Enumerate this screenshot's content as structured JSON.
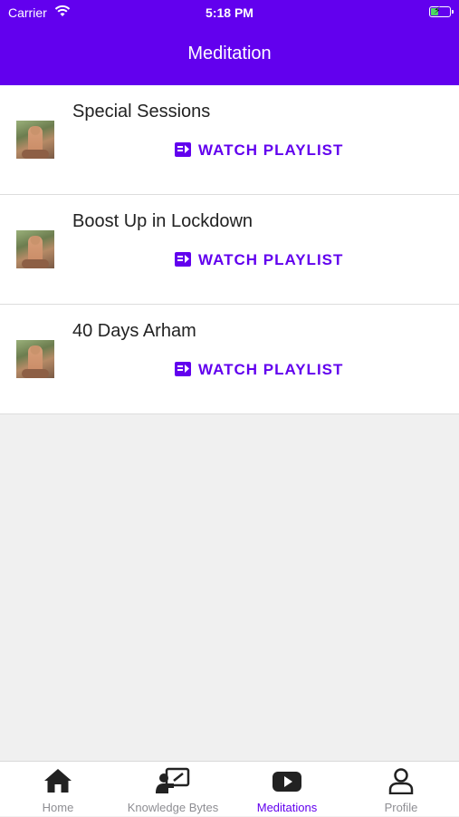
{
  "status_bar": {
    "carrier": "Carrier",
    "time": "5:18 PM",
    "battery_level": 0.4
  },
  "header": {
    "title": "Meditation"
  },
  "playlists": [
    {
      "title": "Special Sessions",
      "action_label": "WATCH PLAYLIST"
    },
    {
      "title": "Boost Up in Lockdown",
      "action_label": "WATCH PLAYLIST"
    },
    {
      "title": "40 Days Arham",
      "action_label": "WATCH PLAYLIST"
    }
  ],
  "tabs": [
    {
      "label": "Home",
      "icon": "home-icon",
      "active": false
    },
    {
      "label": "Knowledge Bytes",
      "icon": "presenter-board-icon",
      "active": false
    },
    {
      "label": "Meditations",
      "icon": "youtube-play-icon",
      "active": true
    },
    {
      "label": "Profile",
      "icon": "user-outline-icon",
      "active": false
    }
  ],
  "colors": {
    "accent": "#6200ee",
    "inactive_tab": "#8e8e93",
    "background": "#f0f0f0"
  }
}
